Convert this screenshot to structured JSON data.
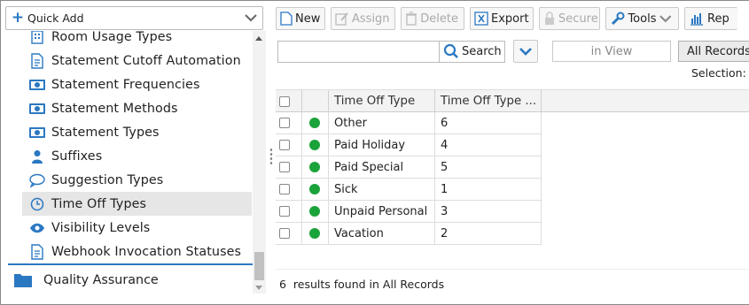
{
  "quick_add": {
    "label": "Quick Add"
  },
  "sidebar": {
    "items": [
      {
        "label": "Room Usage Types",
        "icon": "building-icon"
      },
      {
        "label": "Statement Cutoff Automation",
        "icon": "document-icon"
      },
      {
        "label": "Statement Frequencies",
        "icon": "money-icon"
      },
      {
        "label": "Statement Methods",
        "icon": "money-icon"
      },
      {
        "label": "Statement Types",
        "icon": "money-icon"
      },
      {
        "label": "Suffixes",
        "icon": "person-icon"
      },
      {
        "label": "Suggestion Types",
        "icon": "speech-bubble-icon"
      },
      {
        "label": "Time Off Types",
        "icon": "clock-icon",
        "selected": true
      },
      {
        "label": "Visibility Levels",
        "icon": "eye-icon"
      },
      {
        "label": "Webhook Invocation Statuses",
        "icon": "document-icon"
      }
    ],
    "section": {
      "label": "Quality Assurance",
      "icon": "folder-icon"
    }
  },
  "toolbar": {
    "new": "New",
    "assign": "Assign",
    "delete": "Delete",
    "export": "Export",
    "secure": "Secure",
    "tools": "Tools",
    "reports": "Rep"
  },
  "search": {
    "button": "Search",
    "value": ""
  },
  "view": {
    "in_view": "in View",
    "all_records": "All Records",
    "selection": "Selection:"
  },
  "grid": {
    "columns": [
      "Time Off Type",
      "Time Off Type ..."
    ],
    "rows": [
      {
        "type": "Other",
        "code": "6"
      },
      {
        "type": "Paid Holiday",
        "code": "4"
      },
      {
        "type": "Paid Special",
        "code": "5"
      },
      {
        "type": "Sick",
        "code": "1"
      },
      {
        "type": "Unpaid Personal",
        "code": "3"
      },
      {
        "type": "Vacation",
        "code": "2"
      }
    ],
    "status_color": "#1aa33a"
  },
  "footer": {
    "count": "6",
    "results_text": "results found in All Records"
  },
  "colors": {
    "accent": "#2b78c2"
  }
}
